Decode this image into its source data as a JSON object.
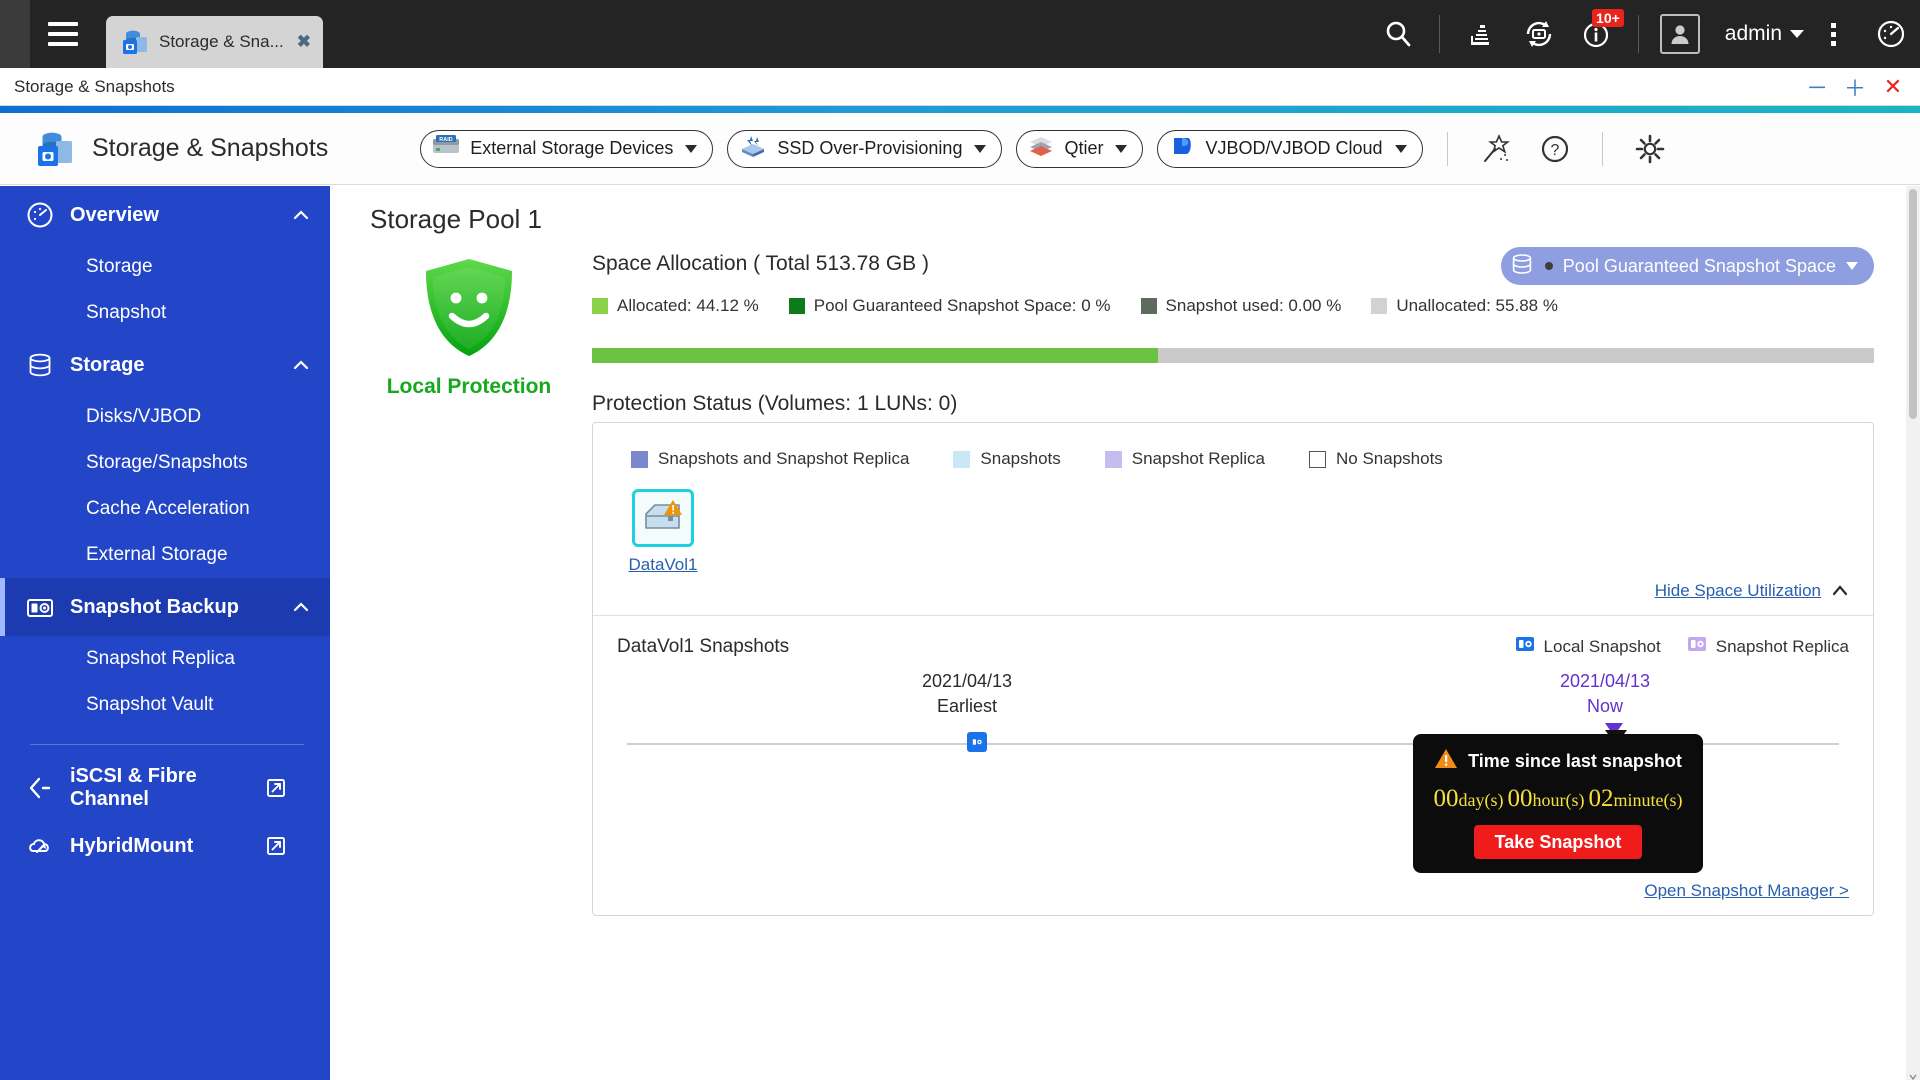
{
  "osbar": {
    "tab": {
      "label": "Storage & Sna...",
      "icon": "storage-snapshots-icon",
      "close": "✖"
    },
    "icons": [
      {
        "name": "search-icon",
        "label": "Search"
      },
      {
        "name": "resource-monitor-icon",
        "label": "Resource Monitor"
      },
      {
        "name": "backup-sync-icon",
        "label": "Backup & Sync"
      },
      {
        "name": "notification-info-icon",
        "label": "Notifications",
        "badge": "10+"
      }
    ],
    "user": {
      "name": "admin",
      "avatar": "user-avatar-icon"
    },
    "kebab": "more-options-icon",
    "dashboard": "dashboard-gauge-icon"
  },
  "window": {
    "title": "Storage & Snapshots",
    "minimize": "─",
    "maximize": "＋",
    "close": "✕"
  },
  "appheader": {
    "title": "Storage & Snapshots",
    "toolbar": [
      {
        "label": "External Storage Devices",
        "icon": "raid-device-icon"
      },
      {
        "label": "SSD Over-Provisioning",
        "icon": "ssd-icon"
      },
      {
        "label": "Qtier",
        "icon": "qtier-layers-icon"
      },
      {
        "label": "VJBOD/VJBOD Cloud",
        "icon": "vjbod-cloud-icon"
      }
    ],
    "actions": [
      {
        "name": "wizard-wand-icon"
      },
      {
        "name": "help-icon"
      },
      {
        "name": "settings-gear-icon"
      }
    ]
  },
  "sidebar": {
    "groups": [
      {
        "label": "Overview",
        "icon": "gauge-icon",
        "expanded": true,
        "active": false,
        "items": [
          {
            "label": "Storage"
          },
          {
            "label": "Snapshot"
          }
        ]
      },
      {
        "label": "Storage",
        "icon": "database-icon",
        "expanded": true,
        "active": false,
        "items": [
          {
            "label": "Disks/VJBOD"
          },
          {
            "label": "Storage/Snapshots"
          },
          {
            "label": "Cache Acceleration"
          },
          {
            "label": "External Storage"
          }
        ]
      },
      {
        "label": "Snapshot Backup",
        "icon": "camera-icon",
        "expanded": true,
        "active": true,
        "items": [
          {
            "label": "Snapshot Replica"
          },
          {
            "label": "Snapshot Vault"
          }
        ]
      }
    ],
    "external": [
      {
        "label": "iSCSI & Fibre Channel",
        "icon": "iscsi-icon"
      },
      {
        "label": "HybridMount",
        "icon": "hybridmount-cloud-icon"
      }
    ]
  },
  "main": {
    "pool_title": "Storage Pool 1",
    "protection": {
      "label": "Local Protection",
      "icon": "shield-smile-icon",
      "color": "#16a81e"
    },
    "space_allocation": {
      "title": "Space Allocation ( Total 513.78 GB )",
      "legend": [
        {
          "label": "Allocated: 44.12 %",
          "color": "#8cd14a"
        },
        {
          "label": "Pool Guaranteed Snapshot Space: 0 %",
          "color": "#0f7a18"
        },
        {
          "label": "Snapshot used: 0.00 %",
          "color": "#5d6b5d"
        },
        {
          "label": "Unallocated: 55.88 %",
          "color": "#d2d2d2"
        }
      ],
      "pgss_button": {
        "label": "Pool Guaranteed Snapshot Space",
        "icon": "database-icon"
      },
      "bar_allocated_pct": 44.12
    },
    "protection_status": {
      "title": "Protection Status (Volumes: 1 LUNs: 0)",
      "legend": [
        {
          "label": "Snapshots and Snapshot Replica",
          "color": "#7b88cc"
        },
        {
          "label": "Snapshots",
          "color": "#c8e8f5"
        },
        {
          "label": "Snapshot Replica",
          "color": "#c3bdf0"
        },
        {
          "label": "No Snapshots",
          "color": "#ffffff"
        }
      ],
      "volumes": [
        {
          "name": "DataVol1",
          "icon": "volume-icon",
          "warning": true
        }
      ],
      "hide_space_link": "Hide Space Utilization"
    },
    "snapshots": {
      "title": "DataVol1 Snapshots",
      "legend": [
        {
          "label": "Local Snapshot",
          "icon": "local-snapshot-icon",
          "color": "#1a73e8"
        },
        {
          "label": "Snapshot Replica",
          "icon": "snapshot-replica-icon",
          "color": "#c3a8f0"
        }
      ],
      "timeline": {
        "earliest_date": "2021/04/13",
        "earliest_label": "Earliest",
        "now_date": "2021/04/13",
        "now_label": "Now"
      },
      "tooltip": {
        "title": "Time since last snapshot",
        "warning_icon": "warning-triangle-icon",
        "days_value": "00",
        "days_unit": "day(s)",
        "hours_value": "00",
        "hours_unit": "hour(s)",
        "minutes_value": "02",
        "minutes_unit": "minute(s)",
        "button": "Take Snapshot"
      },
      "open_manager_link": "Open Snapshot Manager >"
    }
  }
}
